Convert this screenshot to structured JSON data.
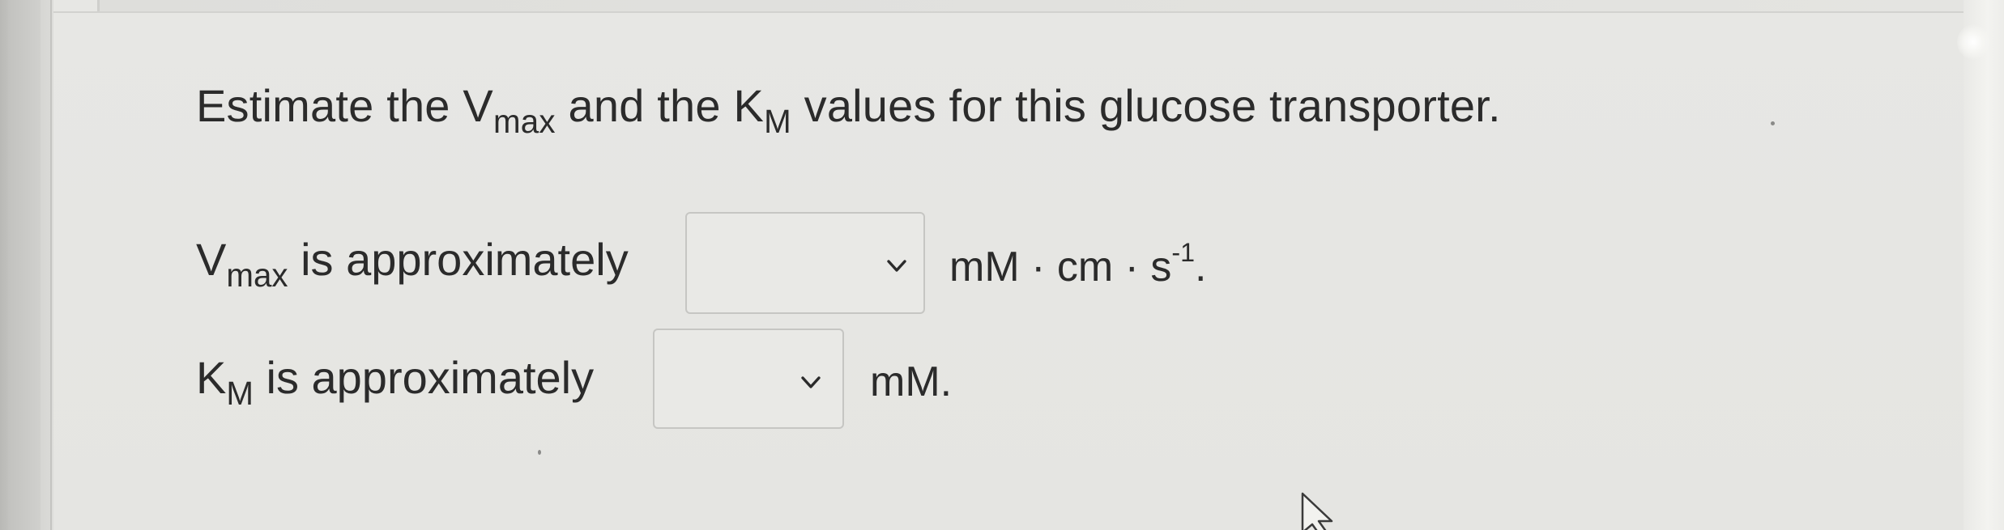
{
  "question": {
    "prefix": "Estimate the ",
    "vmax_symbol": "V",
    "vmax_subscript": "max",
    "middle": " and the ",
    "km_symbol": "K",
    "km_subscript": "M",
    "suffix": " values for this glucose transporter."
  },
  "vmax_row": {
    "symbol": "V",
    "subscript": "max",
    "text": " is approximately",
    "dropdown_value": "",
    "unit_main": "mM · cm · s",
    "unit_exponent": "-1",
    "unit_end": "."
  },
  "km_row": {
    "symbol": "K",
    "subscript": "M",
    "text": " is approximately",
    "dropdown_value": "",
    "unit": "mM."
  },
  "icons": {
    "dropdown_arrow": "chevron-down-icon",
    "cursor": "mouse-pointer-icon"
  },
  "colors": {
    "text": "#2b2b2b",
    "background": "#e6e6e3",
    "dropdown_border": "#c6c6c3"
  }
}
